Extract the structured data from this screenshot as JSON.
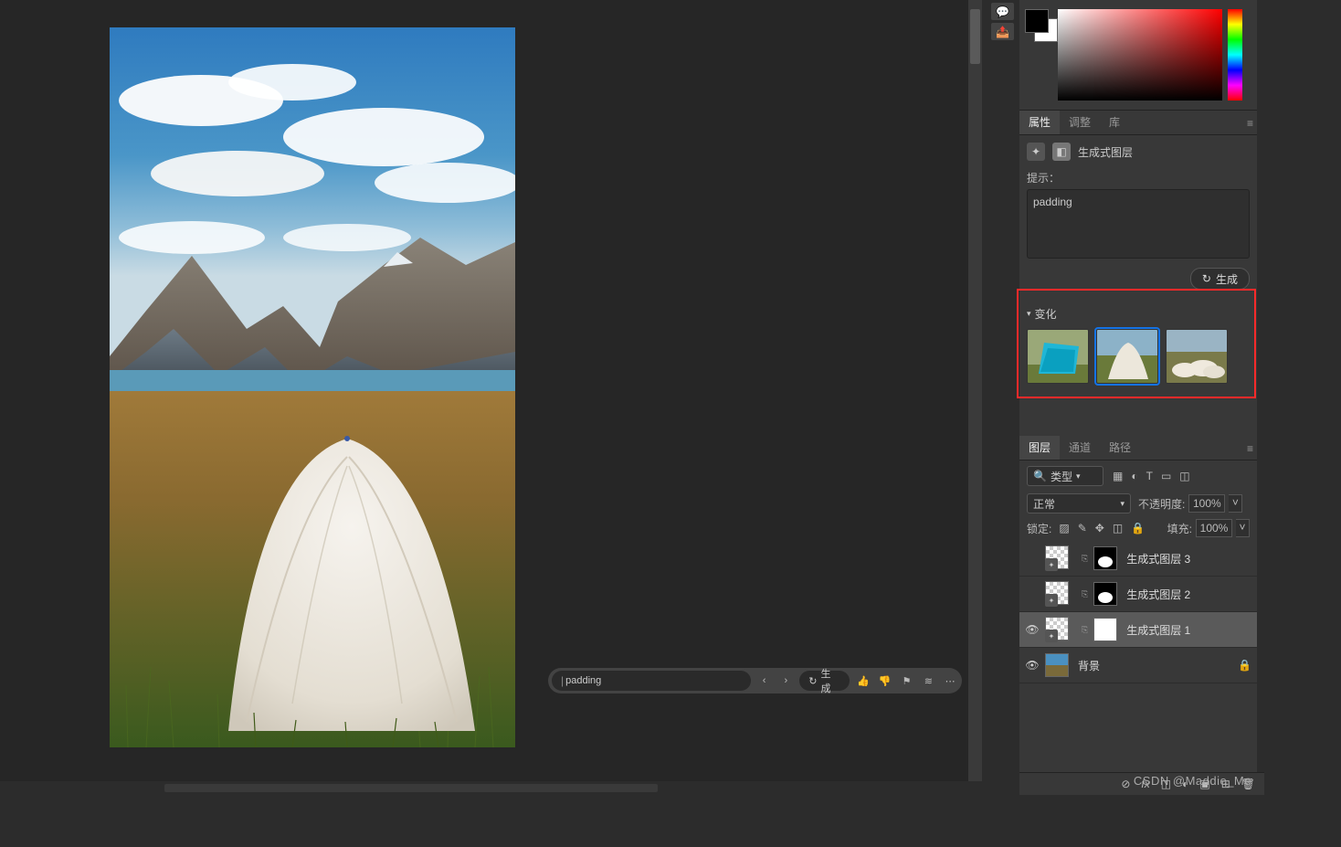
{
  "floating_bar": {
    "prompt": "padding",
    "generate_label": "生成"
  },
  "panels": {
    "properties": {
      "tabs": [
        "属性",
        "调整",
        "库"
      ],
      "active_tab": "属性",
      "layer_type_label": "生成式图层",
      "prompt_label": "提示：",
      "prompt_value": "padding",
      "generate_label": "生成",
      "variations": {
        "title": "变化",
        "selected_index": 1,
        "items": [
          "variation-1",
          "variation-2",
          "variation-3"
        ]
      }
    },
    "layers": {
      "tabs": [
        "图层",
        "通道",
        "路径"
      ],
      "active_tab": "图层",
      "type_filter_label": "类型",
      "blend_mode": "正常",
      "opacity_label": "不透明度:",
      "opacity_value": "100%",
      "lock_label": "锁定:",
      "fill_label": "填充:",
      "fill_value": "100%",
      "layers": [
        {
          "name": "生成式图层 3",
          "visible": false,
          "selected": false,
          "has_mask": true,
          "mask_white": false,
          "is_background": false,
          "locked": false
        },
        {
          "name": "生成式图层 2",
          "visible": false,
          "selected": false,
          "has_mask": true,
          "mask_white": false,
          "is_background": false,
          "locked": false
        },
        {
          "name": "生成式图层 1",
          "visible": true,
          "selected": true,
          "has_mask": true,
          "mask_white": true,
          "is_background": false,
          "locked": false
        },
        {
          "name": "背景",
          "visible": true,
          "selected": false,
          "has_mask": false,
          "mask_white": false,
          "is_background": true,
          "locked": true
        }
      ]
    }
  },
  "watermark": "CSDN @Maddie_Mo"
}
